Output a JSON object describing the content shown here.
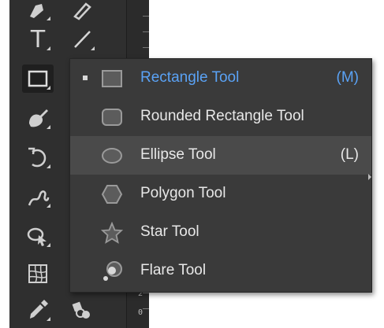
{
  "toolbar": {
    "tools": [
      {
        "name": "pen-icon"
      },
      {
        "name": "pencil-icon"
      },
      {
        "name": "type-tool",
        "glyph": "T"
      },
      {
        "name": "line-segment-icon"
      },
      {
        "name": "rectangle-tool-icon"
      },
      {
        "name": "paintbrush-icon"
      },
      {
        "name": "rotate-icon"
      },
      {
        "name": "warp-icon"
      },
      {
        "name": "shape-builder-icon"
      },
      {
        "name": "mesh-icon"
      },
      {
        "name": "eyedropper-icon"
      },
      {
        "name": "blend-icon"
      }
    ]
  },
  "ruler": {
    "labels": [
      "2",
      "0"
    ]
  },
  "flyout": {
    "items": [
      {
        "label": "Rectangle Tool",
        "shortcut": "(M)",
        "icon": "rectangle-icon",
        "active": true
      },
      {
        "label": "Rounded Rectangle Tool",
        "shortcut": "",
        "icon": "rounded-rectangle-icon"
      },
      {
        "label": "Ellipse Tool",
        "shortcut": "(L)",
        "icon": "ellipse-icon",
        "hover": true
      },
      {
        "label": "Polygon Tool",
        "shortcut": "",
        "icon": "polygon-icon"
      },
      {
        "label": "Star Tool",
        "shortcut": "",
        "icon": "star-icon"
      },
      {
        "label": "Flare Tool",
        "shortcut": "",
        "icon": "flare-icon"
      }
    ]
  },
  "colors": {
    "toolbar_bg": "#2f2f2f",
    "menu_bg": "#3a3a3a",
    "menu_hover": "#4a4a4a",
    "accent": "#5aa2f5",
    "text": "#e8e8e8"
  }
}
